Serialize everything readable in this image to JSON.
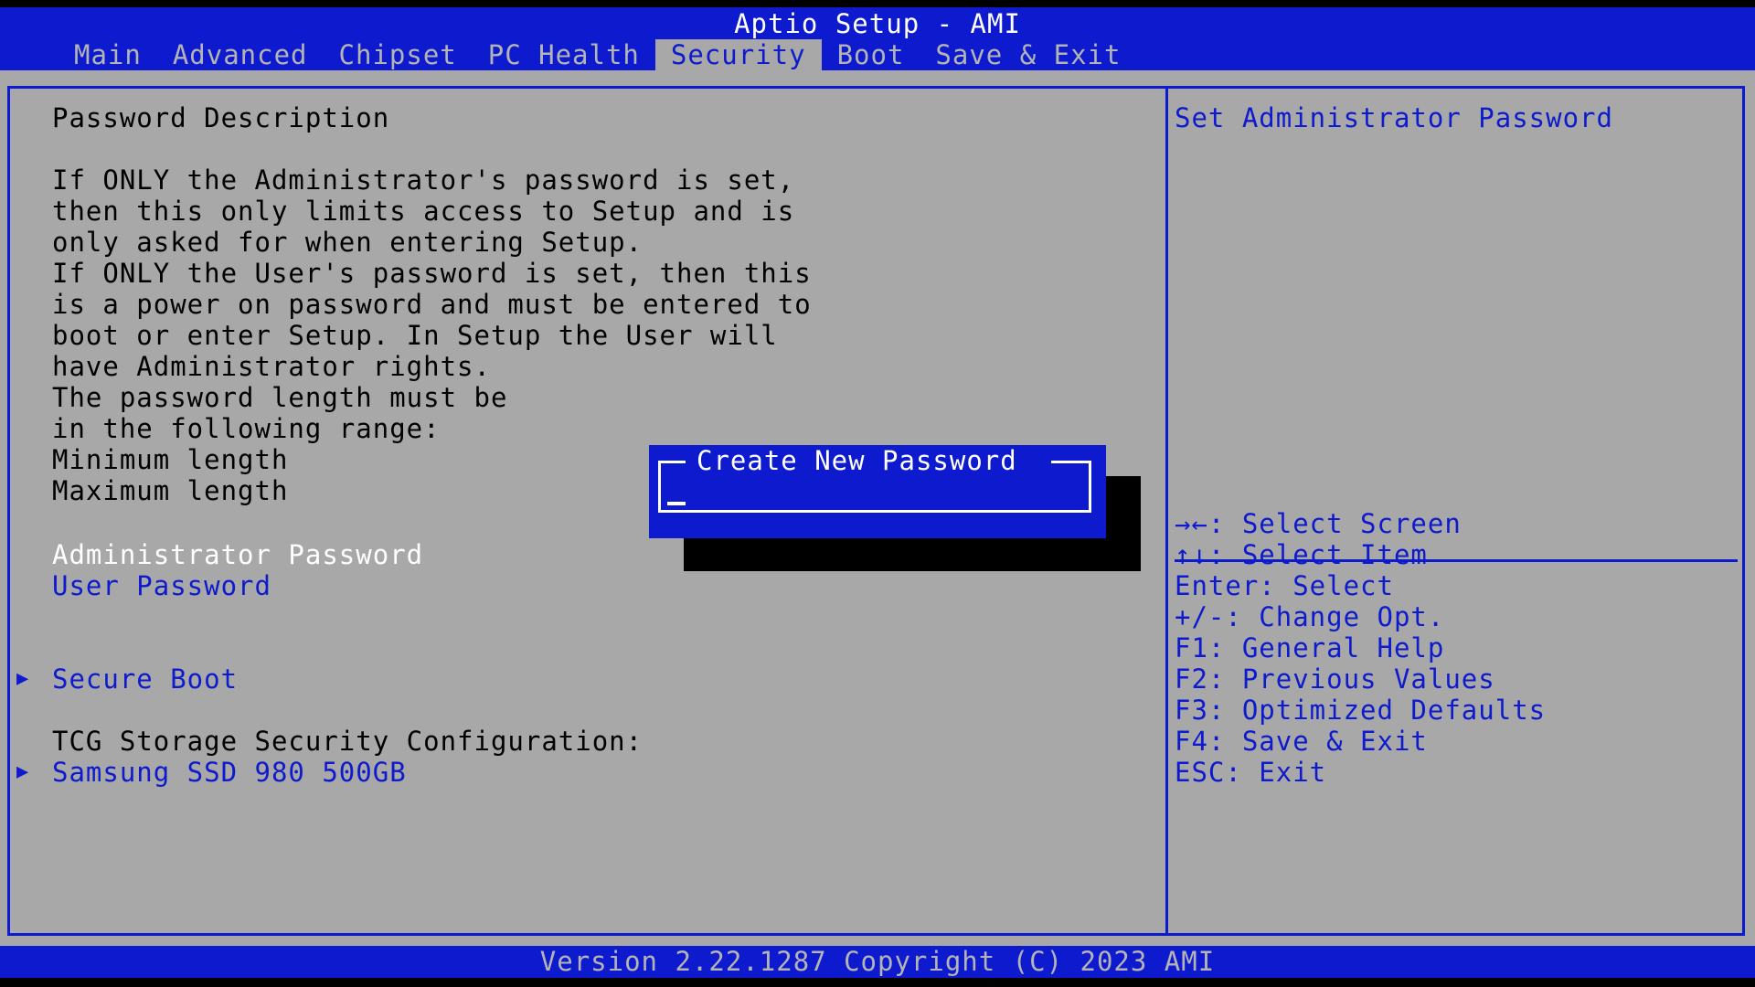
{
  "header": {
    "title": "Aptio Setup - AMI",
    "tabs": [
      "Main",
      "Advanced",
      "Chipset",
      "PC Health",
      "Security",
      "Boot",
      "Save & Exit"
    ],
    "active_tab": "Security"
  },
  "main": {
    "description_title": "Password Description",
    "description_lines": [
      "If ONLY the Administrator's password is set,",
      "then this only limits access to Setup and is",
      "only asked for when entering Setup.",
      "If ONLY the User's password is set, then this",
      "is a power on password and must be entered to",
      "boot or enter Setup. In Setup the User will",
      "have Administrator rights.",
      "The password length must be",
      "in the following range:",
      "Minimum length",
      "Maximum length"
    ],
    "administrator_password": "Administrator Password",
    "user_password": "User Password",
    "secure_boot": "Secure Boot",
    "tcg_heading": "TCG Storage Security Configuration:",
    "storage_device": "Samsung SSD 980 500GB"
  },
  "help": {
    "item_help": "Set Administrator Password",
    "keys": [
      "→←: Select Screen",
      "↑↓: Select Item",
      "Enter: Select",
      "+/-: Change Opt.",
      "F1: General Help",
      "F2: Previous Values",
      "F3: Optimized Defaults",
      "F4: Save & Exit",
      "ESC: Exit"
    ]
  },
  "dialog": {
    "title": "Create New Password",
    "value": ""
  },
  "footer": {
    "version": "Version 2.22.1287 Copyright (C) 2023 AMI"
  },
  "colors": {
    "bios_blue": "#0d1acd",
    "panel_gray": "#a8a8a8",
    "inactive_tab": "#b4b4b4",
    "highlight": "#ffffff"
  }
}
